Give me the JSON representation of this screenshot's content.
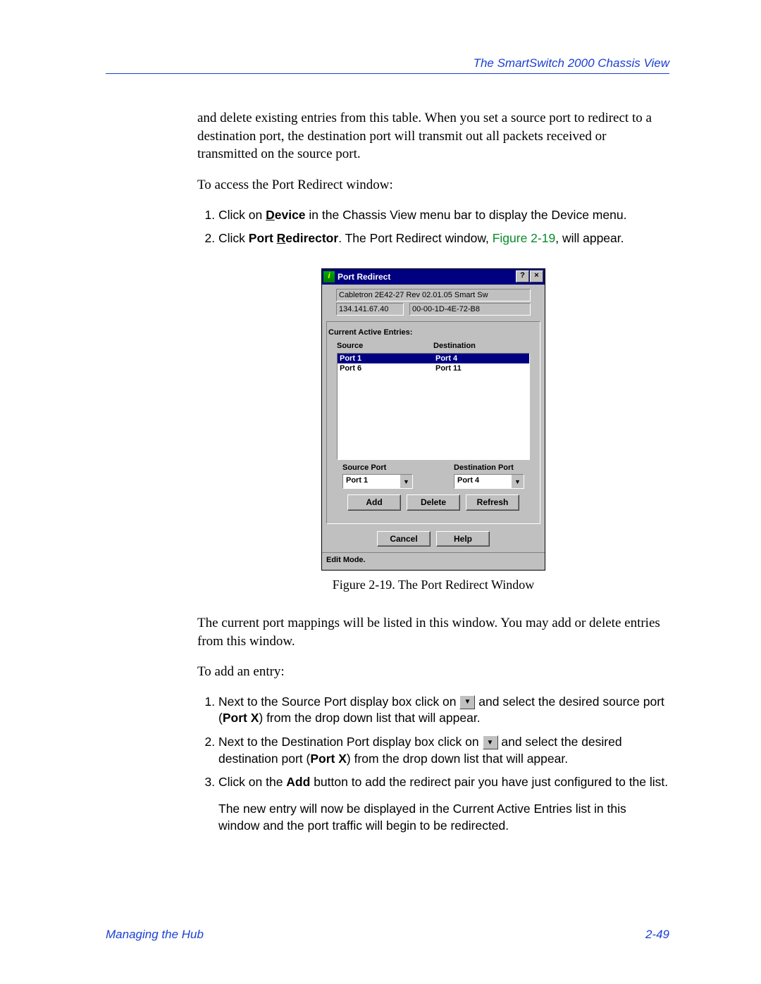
{
  "header": {
    "title": "The SmartSwitch 2000 Chassis View"
  },
  "intro": {
    "p1": "and delete existing entries from this table. When you set a source port to redirect to a destination port, the destination port will transmit out all packets received or transmitted on the source port.",
    "p2": "To access the Port Redirect window:"
  },
  "steps_access": {
    "s1_a": "Click on ",
    "s1_b": "Device",
    "s1_c": " in the Chassis View menu bar to display the Device menu.",
    "s2_a": "Click ",
    "s2_b": "Port Redirector",
    "s2_c": ". The Port Redirect window, ",
    "s2_link": "Figure 2-19",
    "s2_d": ", will appear."
  },
  "dialog": {
    "title": "Port Redirect",
    "help_btn": "?",
    "close_btn": "×",
    "device_line": "Cabletron 2E42-27 Rev 02.01.05 Smart Sw",
    "ip": "134.141.67.40",
    "mac": "00-00-1D-4E-72-B8",
    "group_label": "Current Active Entries:",
    "col_source": "Source",
    "col_dest": "Destination",
    "rows": [
      {
        "src": "Port 1",
        "dst": "Port 4",
        "selected": true
      },
      {
        "src": "Port 6",
        "dst": "Port 11",
        "selected": false
      }
    ],
    "src_port_label": "Source Port",
    "dst_port_label": "Destination Port",
    "src_port_value": "Port 1",
    "dst_port_value": "Port 4",
    "btn_add": "Add",
    "btn_delete": "Delete",
    "btn_refresh": "Refresh",
    "btn_cancel": "Cancel",
    "btn_help": "Help",
    "status": "Edit Mode."
  },
  "caption": "Figure 2-19. The Port Redirect Window",
  "after": {
    "p1": "The current port mappings will be listed in this window. You may add or delete entries from this window.",
    "p2": "To add an entry:"
  },
  "steps_add": {
    "s1_a": "Next to the Source Port display box click on ",
    "s1_b": " and select the desired source port (",
    "s1_bold": "Port X",
    "s1_c": ") from the drop down list that will appear.",
    "s2_a": "Next to the Destination Port display box click on ",
    "s2_b": " and select the desired destination port (",
    "s2_bold": "Port X",
    "s2_c": ") from the drop down list that will appear.",
    "s3_a": "Click on the ",
    "s3_bold": "Add",
    "s3_b": " button to add the redirect pair you have just configured to the list.",
    "s3_p2": "The new entry will now be displayed in the Current Active Entries list in this window and the port traffic will begin to be redirected."
  },
  "footer": {
    "left": "Managing the Hub",
    "right": "2-49"
  }
}
